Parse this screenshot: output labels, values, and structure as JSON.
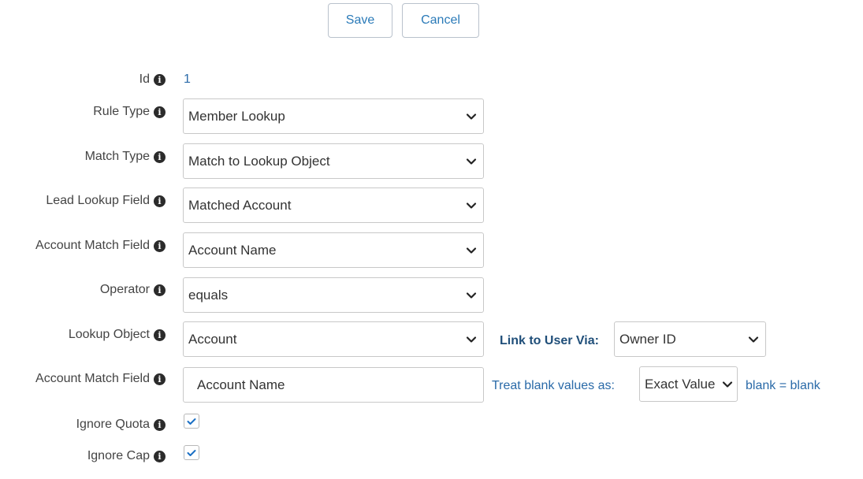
{
  "toolbar": {
    "save_label": "Save",
    "cancel_label": "Cancel"
  },
  "colors": {
    "accent": "#2a7ab8",
    "link_label": "#1f4e79",
    "border": "#c8c8c8"
  },
  "form": {
    "id": {
      "label": "Id",
      "value": "1"
    },
    "rule_type": {
      "label": "Rule Type",
      "value": "Member Lookup"
    },
    "match_type": {
      "label": "Match Type",
      "value": "Match to Lookup Object"
    },
    "lead_lookup_field": {
      "label": "Lead Lookup Field",
      "value": "Matched Account"
    },
    "account_match_field": {
      "label": "Account Match Field",
      "value": "Account Name"
    },
    "operator": {
      "label": "Operator",
      "value": "equals"
    },
    "lookup_object": {
      "label": "Lookup Object",
      "value": "Account",
      "link_label": "Link to User Via:",
      "link_value": "Owner ID"
    },
    "account_match_field_2": {
      "label": "Account Match Field",
      "value": "Account Name",
      "blank_label": "Treat blank values as:",
      "blank_value": "Exact Value",
      "blank_note": "blank = blank"
    },
    "ignore_quota": {
      "label": "Ignore Quota",
      "checked": true
    },
    "ignore_cap": {
      "label": "Ignore Cap",
      "checked": true
    }
  }
}
